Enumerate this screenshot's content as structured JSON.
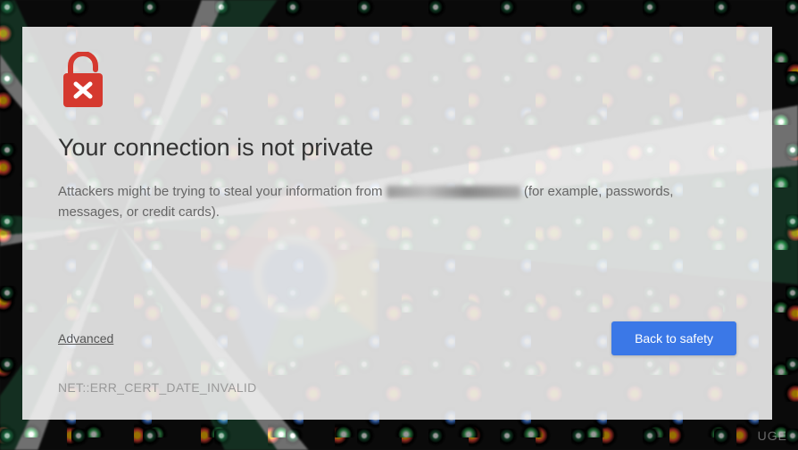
{
  "dialog": {
    "heading": "Your connection is not private",
    "message_prefix": "Attackers might be trying to steal your information from ",
    "message_suffix": " (for example, passwords, messages, or credit cards).",
    "advanced_label": "Advanced",
    "safety_button_label": "Back to safety",
    "error_code": "NET::ERR_CERT_DATE_INVALID"
  },
  "icons": {
    "lock": "lock-broken-icon"
  },
  "colors": {
    "danger": "#d5392f",
    "primary_button": "#3b78e7"
  },
  "watermark": "UGE"
}
